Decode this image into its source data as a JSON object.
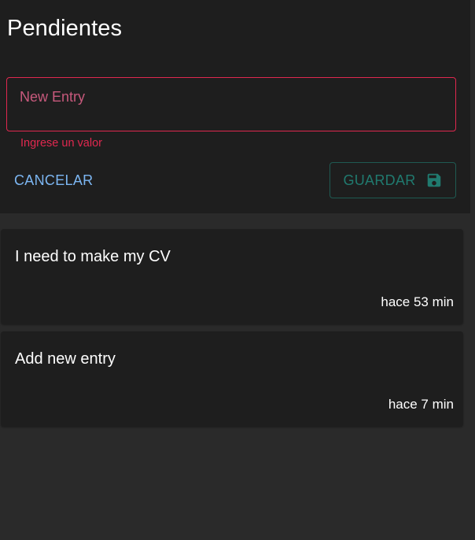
{
  "header": {
    "title": "Pendientes"
  },
  "new_entry": {
    "placeholder": "New Entry",
    "value": "",
    "error_text": "Ingrese un valor",
    "cancel_label": "CANCELAR",
    "save_label": "GUARDAR",
    "save_icon": "floppy-disk-icon"
  },
  "entries": [
    {
      "text": "I need to make my CV",
      "time": "hace 53 min"
    },
    {
      "text": "Add new entry",
      "time": "hace 7 min"
    }
  ],
  "colors": {
    "background": "#2a2a2a",
    "panel": "#1e1e1e",
    "error": "#e0284f",
    "primary": "#7cb6f2",
    "save_disabled": "#207a6f"
  }
}
